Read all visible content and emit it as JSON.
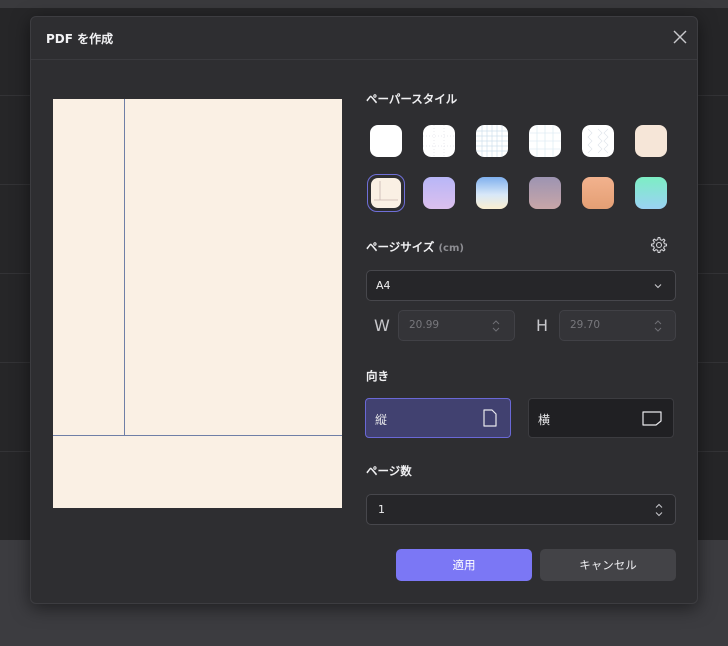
{
  "dialog": {
    "title": "PDF を作成"
  },
  "paper_style": {
    "label": "ペーパースタイル",
    "swatches": [
      {
        "name": "blank-white",
        "color": "#ffffff"
      },
      {
        "name": "dot-grid",
        "color": "#ffffff"
      },
      {
        "name": "square-grid",
        "color": "#ffffff"
      },
      {
        "name": "fine-grid",
        "color": "#ffffff"
      },
      {
        "name": "hex-grid",
        "color": "#ffffff"
      },
      {
        "name": "cream",
        "color": "#f6e6d8"
      },
      {
        "name": "cornell-cream",
        "color": "#faf0e4"
      },
      {
        "name": "lavender-gradient",
        "color": "#c9b9f2"
      },
      {
        "name": "sky-gradient",
        "color": "#a8c8f0"
      },
      {
        "name": "mauve-gradient",
        "color": "#b49aa8"
      },
      {
        "name": "peach-gradient",
        "color": "#e8a57e"
      },
      {
        "name": "mint-gradient",
        "color": "#8fe0d8"
      }
    ],
    "selected": "cornell-cream"
  },
  "page_size": {
    "label": "ページサイズ",
    "unit": "(cm)",
    "value": "A4",
    "w_label": "W",
    "h_label": "H",
    "width": "20.99",
    "height": "29.70"
  },
  "orientation": {
    "label": "向き",
    "portrait": "縦",
    "landscape": "横",
    "selected": "portrait"
  },
  "page_count": {
    "label": "ページ数",
    "value": "1"
  },
  "buttons": {
    "apply": "適用",
    "cancel": "キャンセル"
  },
  "colors": {
    "accent": "#7b77f5",
    "selected_bg": "#414170"
  }
}
